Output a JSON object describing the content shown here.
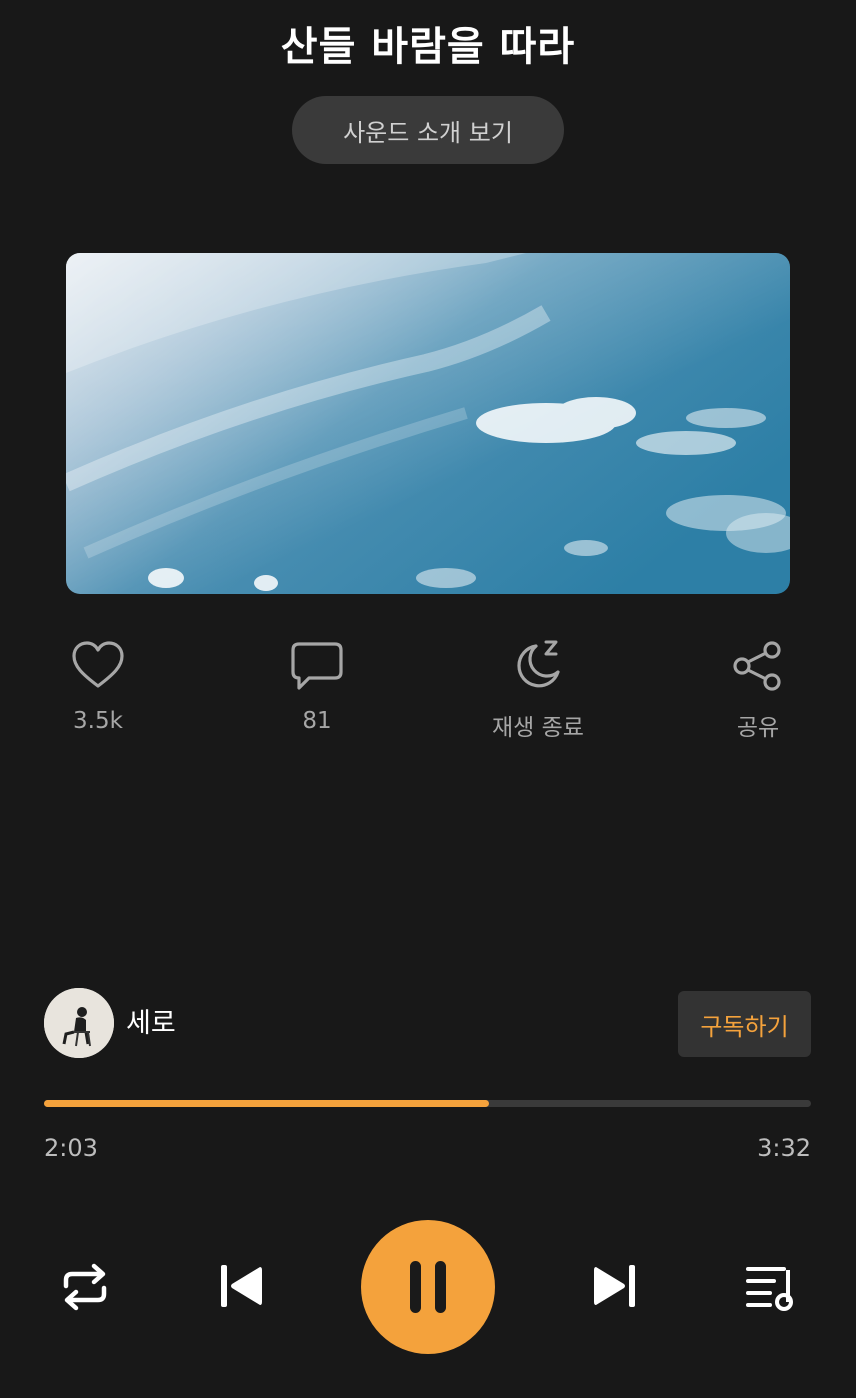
{
  "header": {
    "title": "산들 바람을 따라",
    "intro_button": "사운드 소개 보기"
  },
  "actions": [
    {
      "icon": "heart-icon",
      "label": "3.5k"
    },
    {
      "icon": "comment-icon",
      "label": "81"
    },
    {
      "icon": "sleep-timer-icon",
      "label": "재생 종료"
    },
    {
      "icon": "share-icon",
      "label": "공유"
    }
  ],
  "artist": {
    "name": "세로",
    "subscribe_label": "구독하기"
  },
  "player": {
    "current_time": "2:03",
    "total_time": "3:32",
    "progress_fraction": 0.58,
    "accent_color": "#f4a23c",
    "controls": [
      "repeat-icon",
      "previous-icon",
      "pause-icon",
      "next-icon",
      "playlist-icon"
    ]
  }
}
